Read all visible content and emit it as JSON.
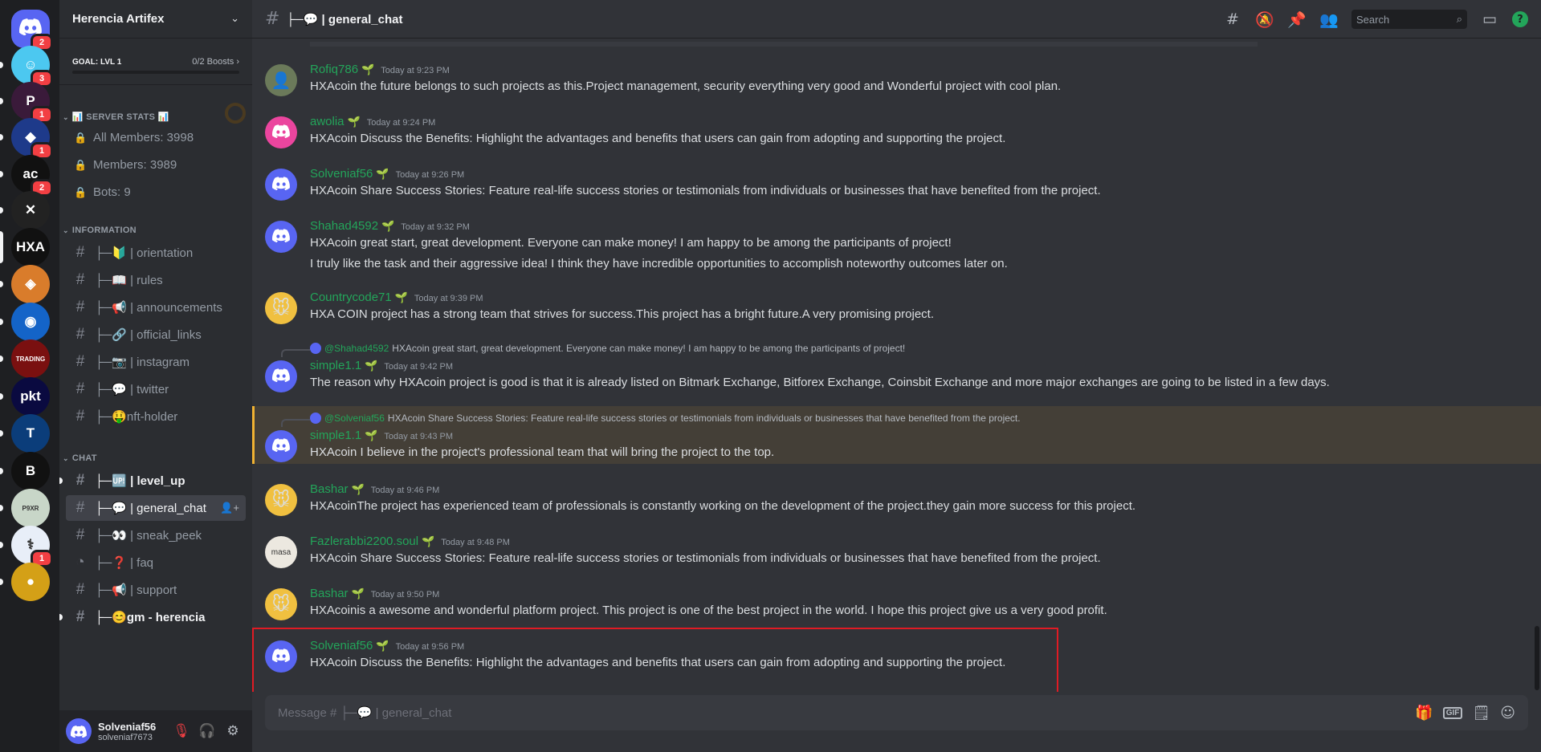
{
  "server": {
    "name": "Herencia Artifex",
    "goal": "GOAL: LVL 1",
    "boosts": "0/2 Boosts"
  },
  "rail": [
    {
      "label": "",
      "badge": "2",
      "color": "#5865f2",
      "icon": "discord-logo"
    },
    {
      "label": "☺",
      "badge": "3",
      "color": "#4cc8f0"
    },
    {
      "label": "P",
      "badge": "1",
      "color": "#3a1a3a"
    },
    {
      "label": "◆",
      "badge": "1",
      "color": "#1e3a8a"
    },
    {
      "label": "ac",
      "badge": "2",
      "color": "#111111"
    },
    {
      "label": "✕",
      "badge": "",
      "color": "#222222"
    },
    {
      "label": "HXA",
      "badge": "",
      "color": "#111111"
    },
    {
      "label": "◈",
      "badge": "",
      "color": "#d97c2b"
    },
    {
      "label": "◉",
      "badge": "",
      "color": "#1464c8"
    },
    {
      "label": "TRADING",
      "badge": "",
      "color": "#7a1010"
    },
    {
      "label": "pkt",
      "badge": "",
      "color": "#0a0a40"
    },
    {
      "label": "T",
      "badge": "",
      "color": "#0b3d7a"
    },
    {
      "label": "B",
      "badge": "",
      "color": "#111111"
    },
    {
      "label": "P9XR",
      "badge": "",
      "color": "#c8d6c8"
    },
    {
      "label": "⚕",
      "badge": "1",
      "color": "#e8eef8"
    },
    {
      "label": "●",
      "badge": "",
      "color": "#d4a017"
    }
  ],
  "stats": {
    "category": "📊 SERVER STATS 📊",
    "items": [
      "All Members: 3998",
      "Members: 3989",
      "Bots: 9"
    ]
  },
  "information": {
    "category": "INFORMATION",
    "channels": [
      "├─🔰 | orientation",
      "├─📖 | rules",
      "├─📢 | announcements",
      "├─🔗 | official_links",
      "├─📷 | instagram",
      "├─💬 | twitter",
      "├─🤑nft-holder"
    ]
  },
  "chat": {
    "category": "CHAT",
    "channels": [
      "├─🆙 | level_up",
      "├─💬 | general_chat",
      "├─👀 | sneak_peek",
      "├─❓ | faq",
      "├─📢 | support",
      "├─😊gm - herencia"
    ]
  },
  "user": {
    "name": "Solveniaf56",
    "tag": "solveniaf7673"
  },
  "topbar": {
    "channel": "├─💬 | general_chat",
    "search_placeholder": "Search"
  },
  "messages": [
    {
      "user": "Rofiq786",
      "time": "Today at 9:23 PM",
      "text": [
        "HXAcoin the future belongs to such projects as this.Project management, security everything very good and Wonderful project with cool plan."
      ],
      "avatar": "photo"
    },
    {
      "user": "awolia",
      "time": "Today at 9:24 PM",
      "text": [
        "HXAcoin Discuss the Benefits: Highlight the advantages and benefits that users can gain from adopting and supporting the project."
      ],
      "avatar": "pink"
    },
    {
      "user": "Solveniaf56",
      "time": "Today at 9:26 PM",
      "text": [
        "HXAcoin Share Success Stories: Feature real-life success stories or testimonials from individuals or businesses that have benefited from the project."
      ],
      "avatar": "blurple"
    },
    {
      "user": "Shahad4592",
      "time": "Today at 9:32 PM",
      "text": [
        "HXAcoin great start, great development. Everyone can make money! I am happy to be among the participants of project!",
        "I truly like the task and their aggressive idea! I think they have incredible opportunities to accomplish noteworthy outcomes later on."
      ],
      "avatar": "blurple"
    },
    {
      "user": "Countrycode71",
      "time": "Today at 9:39 PM",
      "text": [
        "HXA COIN project has a strong team that strives for success.This project has a bright future.A very promising project."
      ],
      "avatar": "pokemon"
    },
    {
      "user": "simple1.1",
      "time": "Today at 9:42 PM",
      "reply_to": "@Shahad4592",
      "reply_text": "HXAcoin great start, great development. Everyone can make money! I am happy to be among the participants of project!",
      "text": [
        "The reason why HXAcoin project is good is that it is already listed on Bitmark Exchange, Bitforex Exchange, Coinsbit Exchange and more major exchanges are going to be listed in a few days."
      ],
      "avatar": "blurple"
    },
    {
      "user": "simple1.1",
      "time": "Today at 9:43 PM",
      "reply_to": "@Solveniaf56",
      "reply_text": "HXAcoin Share Success Stories: Feature real-life success stories or testimonials from individuals or businesses that have benefited from the project.",
      "text": [
        "HXAcoin I believe in the project's professional team that will bring the project to the top."
      ],
      "avatar": "blurple"
    },
    {
      "user": "Bashar",
      "time": "Today at 9:46 PM",
      "text": [
        "HXAcoinThe project has experienced team of professionals is constantly working on the development of the project.they gain more success for this project."
      ],
      "avatar": "pokemon"
    },
    {
      "user": "Fazlerabbi2200.soul",
      "time": "Today at 9:48 PM",
      "text": [
        "HXAcoin Share Success Stories: Feature real-life success stories or testimonials from individuals or businesses that have benefited from the project."
      ],
      "avatar": "masa"
    },
    {
      "user": "Bashar",
      "time": "Today at 9:50 PM",
      "text": [
        "HXAcoinis a awesome and wonderful platform project. This project is one of the best project in the world. I hope this project give us a very good profit."
      ],
      "avatar": "pokemon"
    },
    {
      "user": "Solveniaf56",
      "time": "Today at 9:56 PM",
      "text": [
        "HXAcoin Discuss the Benefits: Highlight the advantages and benefits that users can gain from adopting and supporting the project."
      ],
      "avatar": "blurple"
    }
  ],
  "masa_label": "masa",
  "composer": {
    "placeholder": "Message # ├─💬 | general_chat",
    "gif_label": "GIF"
  },
  "colors": {
    "accent": "#5865f2",
    "username": "#23a55a",
    "highlight": "#e01b24",
    "mention": "#f0b232"
  }
}
